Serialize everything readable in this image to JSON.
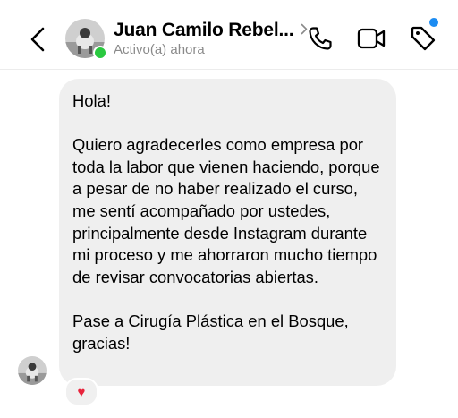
{
  "header": {
    "contact_name": "Juan Camilo Rebel...",
    "status": "Activo(a) ahora",
    "icons": [
      "back-chevron-icon",
      "phone-icon",
      "video-camera-icon",
      "tag-icon"
    ],
    "online_color": "#2ac940",
    "notification_color": "#1c8cf2"
  },
  "message": {
    "paragraphs": [
      "Hola!",
      "Quiero agradecerles como empresa por toda la labor que vienen haciendo, porque a pesar de no haber realizado el curso, me sentí acompañado por ustedes, principalmente desde Instagram durante mi proceso y me ahorraron mucho tiempo de revisar convocatorias abiertas.",
      "Pase a Cirugía Plástica en el Bosque, gracias!"
    ],
    "reaction": "♥",
    "reaction_color": "#e8233c"
  }
}
